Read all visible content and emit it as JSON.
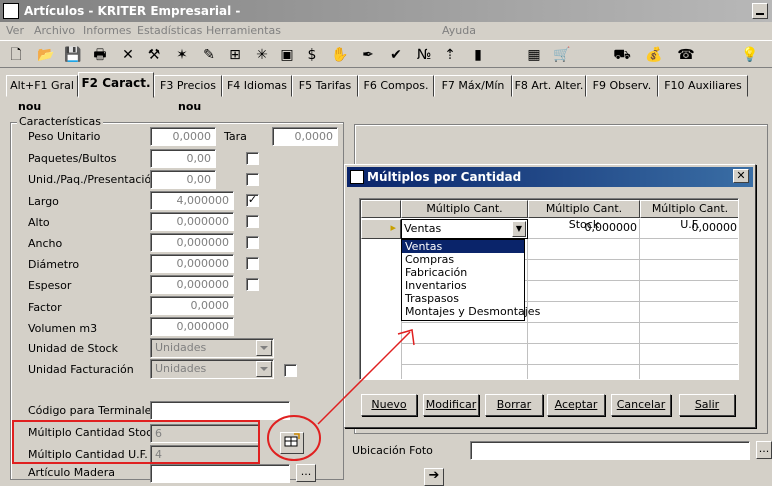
{
  "window": {
    "title": "Artículos - KRITER Empresarial -"
  },
  "menu": [
    "Ver",
    "Archivo",
    "Informes",
    "Estadísticas",
    "Herramientas",
    "Ayuda"
  ],
  "tabs": [
    "Alt+F1 Gral",
    "F2 Caract.",
    "F3 Precios",
    "F4 Idiomas",
    "F5 Tarifas",
    "F6 Compos.",
    "F7 Máx/Mín",
    "F8 Art. Alter.",
    "F9 Observ.",
    "F10 Auxiliares"
  ],
  "header": {
    "nou1": "nou",
    "nou2": "nou"
  },
  "caracteristicas": {
    "title": "Características",
    "peso_label": "Peso Unitario",
    "peso_value": "0,0000",
    "tara_label": "Tara",
    "tara_value": "0,0000",
    "paquetes_label": "Paquetes/Bultos",
    "paquetes_value": "0,00",
    "unid_label": "Unid./Paq./Presentación",
    "unid_value": "0,00",
    "largo_label": "Largo",
    "largo_value": "4,000000",
    "alto_label": "Alto",
    "alto_value": "0,000000",
    "ancho_label": "Ancho",
    "ancho_value": "0,000000",
    "diametro_label": "Diámetro",
    "diametro_value": "0,000000",
    "espesor_label": "Espesor",
    "espesor_value": "0,000000",
    "factor_label": "Factor",
    "factor_value": "0,0000",
    "volumen_label": "Volumen m3",
    "volumen_value": "0,000000",
    "unidad_stock_label": "Unidad de Stock",
    "unidad_stock_value": "Unidades",
    "unidad_fact_label": "Unidad Facturación",
    "unidad_fact_value": "Unidades",
    "codigo_label": "Código para Terminales",
    "mult_stock_label": "Múltiplo Cantidad Stock",
    "mult_stock_value": "6",
    "mult_uf_label": "Múltiplo Cantidad U.F.",
    "mult_uf_value": "4",
    "madera_label": "Artículo Madera",
    "ellipsis": "..."
  },
  "foto": {
    "label": "Ubicación Foto",
    "ellipsis": "..."
  },
  "dialog": {
    "title": "Múltiplos por Cantidad",
    "close": "✕",
    "columns": [
      "Múltiplo Cant.",
      "Múltiplo Cant. Stock",
      "Múltiplo Cant. U.F."
    ],
    "row": {
      "tipo": "Ventas",
      "stock": "0,000000",
      "uf": "0,00000"
    },
    "options": [
      "Ventas",
      "Compras",
      "Fabricación",
      "Inventarios",
      "Traspasos",
      "Montajes y Desmontajes"
    ],
    "selected_option": "Ventas",
    "buttons": [
      "Nuevo",
      "Modificar",
      "Borrar",
      "Aceptar",
      "Cancelar",
      "Salir"
    ]
  },
  "colors": {
    "annotation_red": "#e02020",
    "selection_blue": "#0a246a"
  }
}
